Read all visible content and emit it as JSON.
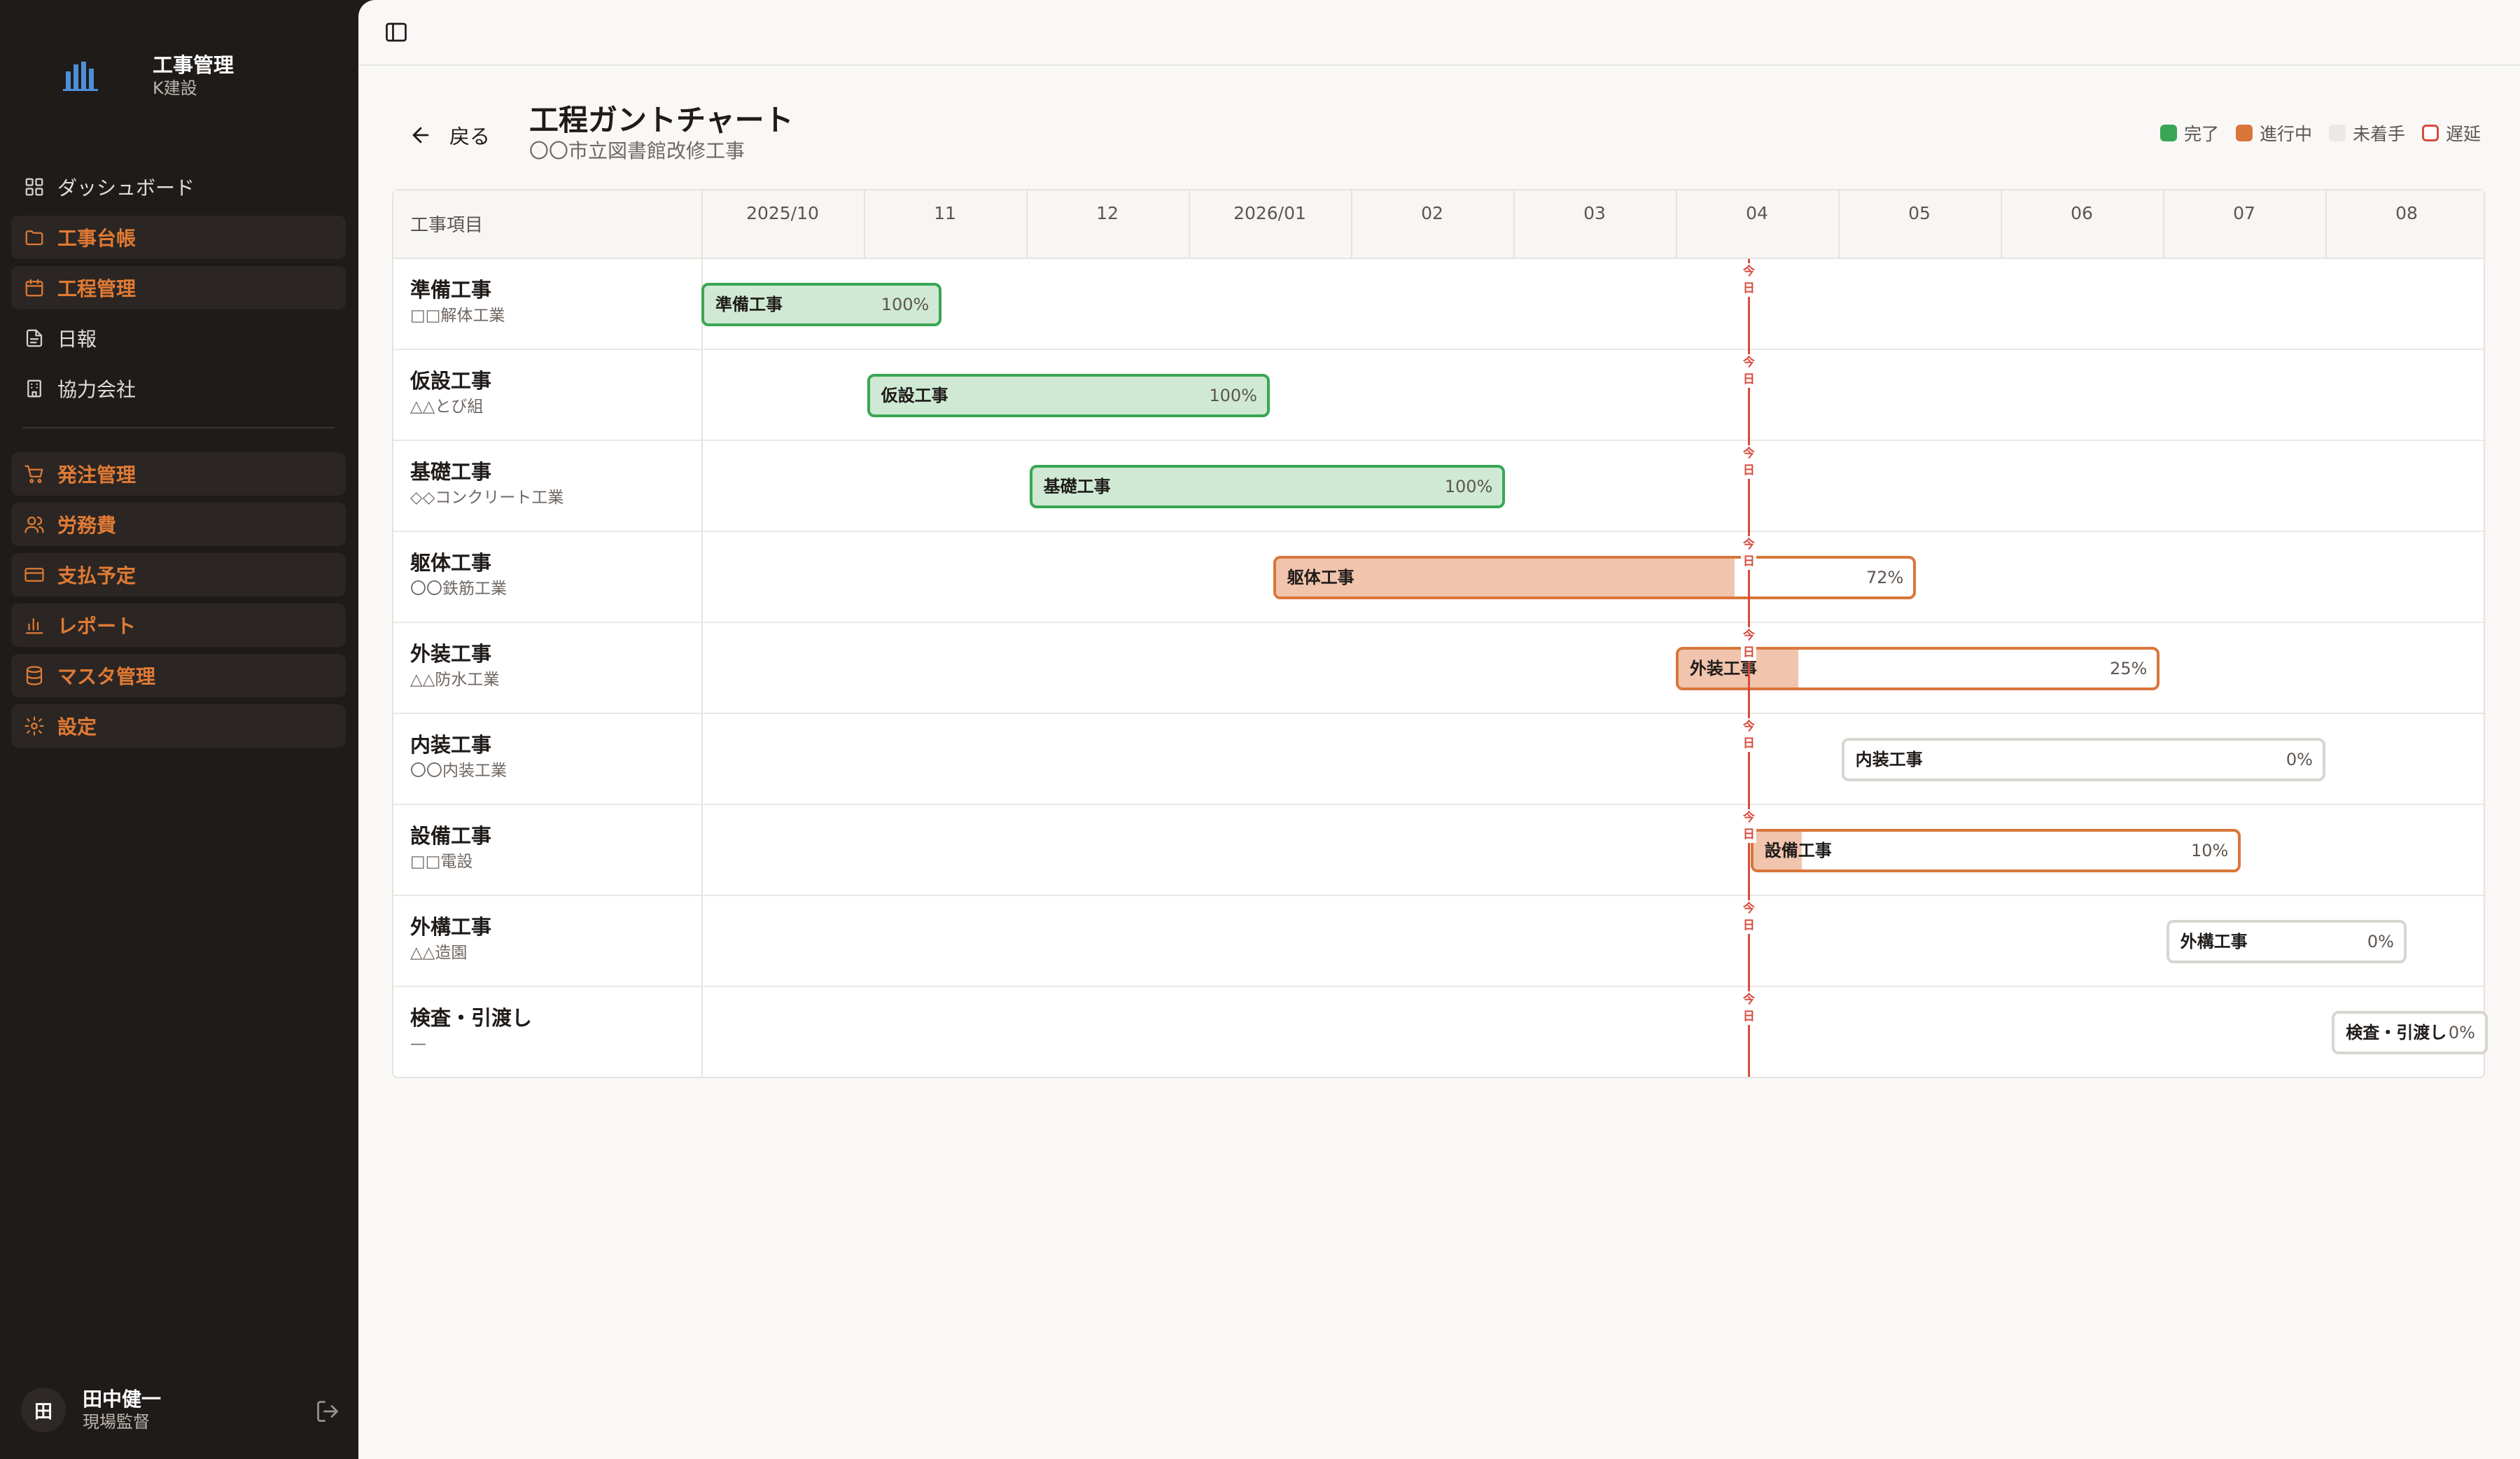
{
  "sidebar": {
    "brand_title": "工事管理",
    "brand_sub": "K建設",
    "items": [
      {
        "label": "ダッシュボード",
        "icon": "grid-icon",
        "accent": false
      },
      {
        "label": "工事台帳",
        "icon": "folder-icon",
        "accent": true
      },
      {
        "label": "工程管理",
        "icon": "calendar-icon",
        "accent": true
      },
      {
        "label": "日報",
        "icon": "document-icon",
        "accent": false
      },
      {
        "label": "協力会社",
        "icon": "building-icon",
        "accent": false
      },
      {
        "label": "発注管理",
        "icon": "cart-icon",
        "accent": true
      },
      {
        "label": "労務費",
        "icon": "users-icon",
        "accent": true
      },
      {
        "label": "支払予定",
        "icon": "card-icon",
        "accent": true
      },
      {
        "label": "レポート",
        "icon": "bar-chart-icon",
        "accent": true
      },
      {
        "label": "マスタ管理",
        "icon": "database-icon",
        "accent": true
      },
      {
        "label": "設定",
        "icon": "gear-icon",
        "accent": true
      }
    ],
    "user": {
      "initial": "田",
      "name": "田中健一",
      "role": "現場監督"
    }
  },
  "header": {
    "back_label": "戻る",
    "title": "工程ガントチャート",
    "subtitle": "〇〇市立図書館改修工事",
    "legend": [
      {
        "label": "完了",
        "color": "#3aa653",
        "fill": "#3aa653"
      },
      {
        "label": "進行中",
        "color": "#d9763a",
        "fill": "#d9763a"
      },
      {
        "label": "未着手",
        "color": "#ebe8e5",
        "fill": "#ebe8e5"
      },
      {
        "label": "遅延",
        "color": "#d94a3e",
        "fill": "#ffffff"
      }
    ]
  },
  "gantt": {
    "task_column_label": "工事項目",
    "months": [
      "2025/10",
      "11",
      "12",
      "2026/01",
      "02",
      "03",
      "04",
      "05",
      "06",
      "07",
      "08"
    ],
    "today_label": "今日",
    "today_month_offset": 6.45,
    "tasks": [
      {
        "name": "準備工事",
        "vendor": "□□解体工業",
        "bar_label": "準備工事",
        "status": "done",
        "start": 0.0,
        "end": 1.48,
        "progress": 100,
        "pct_label": "100%"
      },
      {
        "name": "仮設工事",
        "vendor": "△△とび組",
        "bar_label": "仮設工事",
        "status": "done",
        "start": 1.02,
        "end": 3.5,
        "progress": 100,
        "pct_label": "100%"
      },
      {
        "name": "基礎工事",
        "vendor": "◇◇コンクリート工業",
        "bar_label": "基礎工事",
        "status": "done",
        "start": 2.02,
        "end": 4.95,
        "progress": 100,
        "pct_label": "100%"
      },
      {
        "name": "躯体工事",
        "vendor": "〇〇鉄筋工業",
        "bar_label": "躯体工事",
        "status": "progress",
        "start": 3.52,
        "end": 7.48,
        "progress": 72,
        "pct_label": "72%"
      },
      {
        "name": "外装工事",
        "vendor": "△△防水工業",
        "bar_label": "外装工事",
        "status": "progress",
        "start": 6.0,
        "end": 8.98,
        "progress": 25,
        "pct_label": "25%"
      },
      {
        "name": "内装工事",
        "vendor": "〇〇内装工業",
        "bar_label": "内装工事",
        "status": "pending",
        "start": 7.02,
        "end": 10.0,
        "progress": 0,
        "pct_label": "0%"
      },
      {
        "name": "設備工事",
        "vendor": "□□電設",
        "bar_label": "設備工事",
        "status": "progress",
        "start": 6.46,
        "end": 9.48,
        "progress": 10,
        "pct_label": "10%"
      },
      {
        "name": "外構工事",
        "vendor": "△△造園",
        "bar_label": "外構工事",
        "status": "pending",
        "start": 9.02,
        "end": 10.5,
        "progress": 0,
        "pct_label": "0%"
      },
      {
        "name": "検査・引渡し",
        "vendor": "—",
        "bar_label": "検査・引渡し",
        "status": "pending",
        "start": 10.04,
        "end": 11.0,
        "progress": 0,
        "pct_label": "0%"
      }
    ]
  }
}
